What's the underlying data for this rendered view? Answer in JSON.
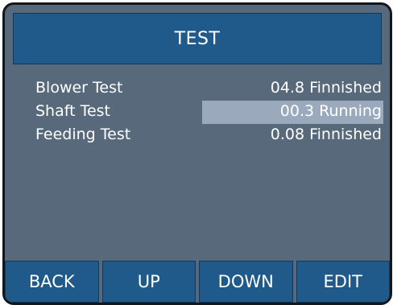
{
  "screen": {
    "title": "TEST"
  },
  "tests": [
    {
      "name": "Blower Test",
      "status": "04.8 Finnished",
      "selected": false
    },
    {
      "name": "Shaft Test",
      "status": "00.3 Running",
      "selected": true
    },
    {
      "name": "Feeding Test",
      "status": "0.08 Finnished",
      "selected": false
    }
  ],
  "softkeys": {
    "back": "BACK",
    "up": "UP",
    "down": "DOWN",
    "edit": "EDIT"
  },
  "colors": {
    "panel_background": "#57697a",
    "bar_blue": "#1f5a8a",
    "selection_highlight": "#9aaabc",
    "text": "#ffffff"
  }
}
